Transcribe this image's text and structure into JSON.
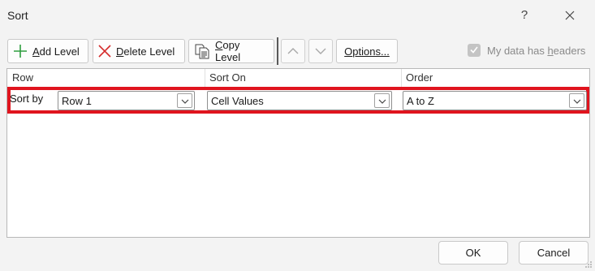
{
  "window": {
    "title": "Sort",
    "help_label": "?"
  },
  "toolbar": {
    "add_level": {
      "access_key": "A",
      "rest": "dd Level"
    },
    "delete_level": {
      "access_key": "D",
      "rest": "elete Level"
    },
    "copy_level": {
      "access_key": "C",
      "rest": "opy Level"
    },
    "options": {
      "access_key": "O",
      "rest": "ptions..."
    },
    "move_up_icon": "chevron-up",
    "move_down_icon": "chevron-down"
  },
  "headers_checkbox": {
    "checked": true,
    "label_before": "My data has ",
    "access_key": "h",
    "label_after": "eaders"
  },
  "columns": {
    "row": "Row",
    "sort_on": "Sort On",
    "order": "Order"
  },
  "level": {
    "label": "Sort by",
    "row_value": "Row 1",
    "sort_on_value": "Cell Values",
    "order_value": "A to Z"
  },
  "footer": {
    "ok": "OK",
    "cancel": "Cancel"
  },
  "colors": {
    "highlight": "#e0141e",
    "add_icon": "#2e9e3e",
    "delete_icon": "#d42a2a"
  }
}
